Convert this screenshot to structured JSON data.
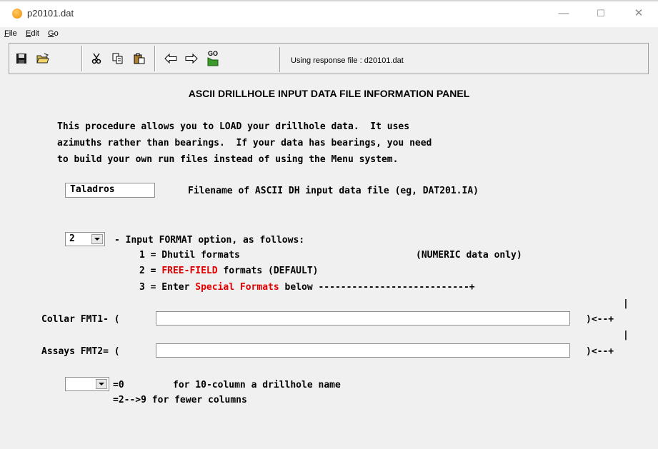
{
  "window": {
    "title": "p20101.dat",
    "minimize": "—",
    "maximize": "☐",
    "close": "✕"
  },
  "menu": [
    {
      "first": "F",
      "rest": "ile"
    },
    {
      "first": "E",
      "rest": "dit"
    },
    {
      "first": "G",
      "rest": "o"
    }
  ],
  "toolbar": {
    "go_label": "GO",
    "status": "Using response file : d20101.dat"
  },
  "panel": {
    "title": "ASCII DRILLHOLE INPUT DATA FILE INFORMATION PANEL",
    "intro": [
      "This procedure allows you to LOAD your drillhole data.  It uses",
      "azimuths rather than bearings.  If your data has bearings, you need",
      "to build your own run files instead of using the Menu system."
    ],
    "filename_value": "Taladros",
    "filename_label": "Filename of ASCII DH input data file (eg, DAT201.IA)",
    "format_value": "2",
    "format_heading": "- Input FORMAT option, as follows:",
    "opt1": "1 = Dhutil formats",
    "opt1_note": "(NUMERIC data only)",
    "opt2_prefix": "2 = ",
    "opt2_red": "FREE-FIELD",
    "opt2_suffix": " formats (DEFAULT)",
    "opt3_prefix": "3 = Enter ",
    "opt3_red": "Special Formats",
    "opt3_suffix": " below ---------------------------+",
    "collar_label": "Collar FMT1- (",
    "assays_label": "Assays FMT2= (",
    "fmt_close": ")<--+",
    "pipe": "|",
    "col_value": "",
    "col_line1_eq": "=0",
    "col_line1_text": "for 10-column a drillhole name",
    "col_line2": "=2-->9 for fewer columns"
  }
}
